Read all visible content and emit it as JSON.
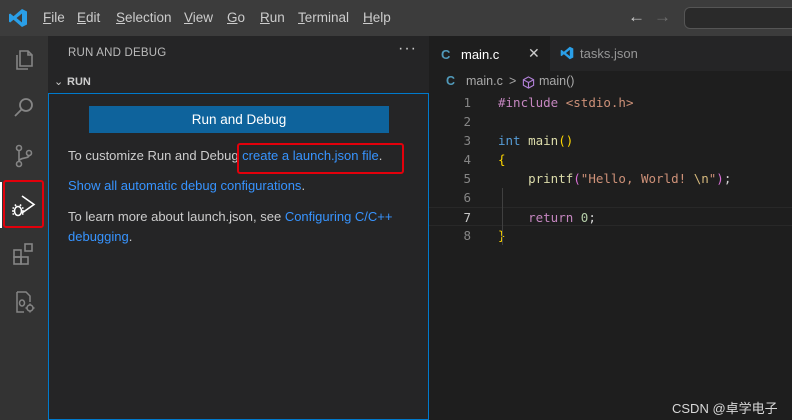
{
  "menu": [
    "File",
    "Edit",
    "Selection",
    "View",
    "Go",
    "Run",
    "Terminal",
    "Help"
  ],
  "menu_underline": [
    "F",
    "E",
    "S",
    "V",
    "G",
    "R",
    "T",
    "H"
  ],
  "menu_rest": [
    "ile",
    "dit",
    "election",
    "iew",
    "o",
    "un",
    "erminal",
    "elp"
  ],
  "sidebar": {
    "title": "RUN AND DEBUG",
    "more": "···",
    "section": "RUN",
    "run_button": "Run and Debug",
    "customize_prefix": "To customize Run and Debug ",
    "customize_link": "create a launch.json file",
    "customize_suffix": ".",
    "show_link": "Show all automatic debug configurations",
    "show_suffix": ".",
    "learn_prefix": "To learn more about launch.json, see ",
    "learn_link": "Configuring C/C++ debugging",
    "learn_suffix": "."
  },
  "tabs": [
    {
      "label": "main.c",
      "active": true,
      "icon": "c-file-icon"
    },
    {
      "label": "tasks.json",
      "active": false,
      "icon": "vscode-icon"
    }
  ],
  "breadcrumbs": {
    "file": "main.c",
    "separator": ">",
    "symbol": "main()"
  },
  "code": [
    {
      "n": "1",
      "text": "#include <stdio.h>"
    },
    {
      "n": "2",
      "text": ""
    },
    {
      "n": "3",
      "text": "int main()"
    },
    {
      "n": "4",
      "text": "{"
    },
    {
      "n": "5",
      "text": "    printf(\"Hello, World! \\n\");"
    },
    {
      "n": "6",
      "text": ""
    },
    {
      "n": "7",
      "text": "    return 0;"
    },
    {
      "n": "8",
      "text": "}"
    }
  ],
  "watermark": "CSDN @卓学电子",
  "colors": {
    "accent": "#007acc",
    "link": "#3794ff",
    "button": "#0e639c",
    "highlight_box": "#e3000b"
  }
}
